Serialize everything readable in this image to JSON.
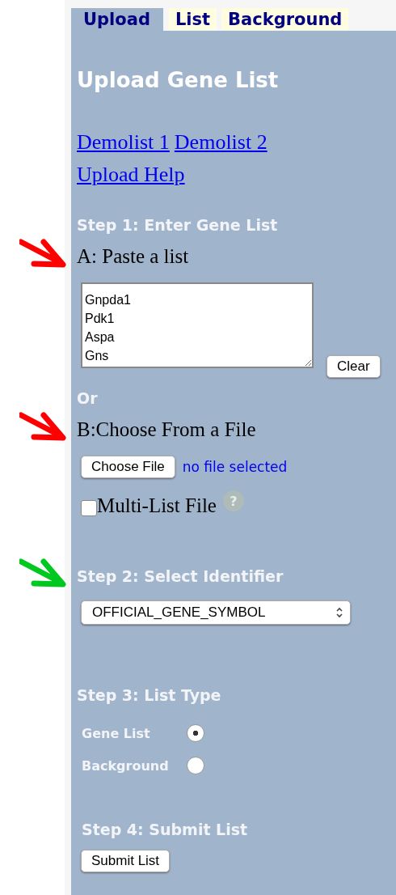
{
  "tabs": [
    {
      "label": "Upload",
      "selected": true
    },
    {
      "label": "List",
      "selected": false
    },
    {
      "label": "Background",
      "selected": false
    }
  ],
  "title": "Upload Gene List",
  "links": [
    "Demolist 1",
    "Demolist 2"
  ],
  "help_link": "Upload Help",
  "step1": {
    "heading": "Step 1: Enter Gene List",
    "paste_label": "A: Paste a list",
    "list_value": "Gnpda1\nPdk1\nAspa\nGns",
    "clear_button": "Clear",
    "or": "Or",
    "file_label": "B:Choose From a File",
    "file_button": "Choose File",
    "file_status": "no file selected",
    "multi_list": {
      "label": "Multi-List File",
      "checked": false
    },
    "help_icon": "?"
  },
  "step2": {
    "heading": "Step 2: Select Identifier",
    "identifier": "OFFICIAL_GENE_SYMBOL"
  },
  "step3": {
    "heading": "Step 3: List Type",
    "options": [
      {
        "label": "Gene List",
        "selected": true
      },
      {
        "label": "Background",
        "selected": false
      }
    ]
  },
  "step4": {
    "heading": "Step 4: Submit List",
    "button": "Submit List"
  },
  "annotations": [
    {
      "color": "#ff0000"
    },
    {
      "color": "#ff0000"
    },
    {
      "color": "#00c81e"
    }
  ]
}
